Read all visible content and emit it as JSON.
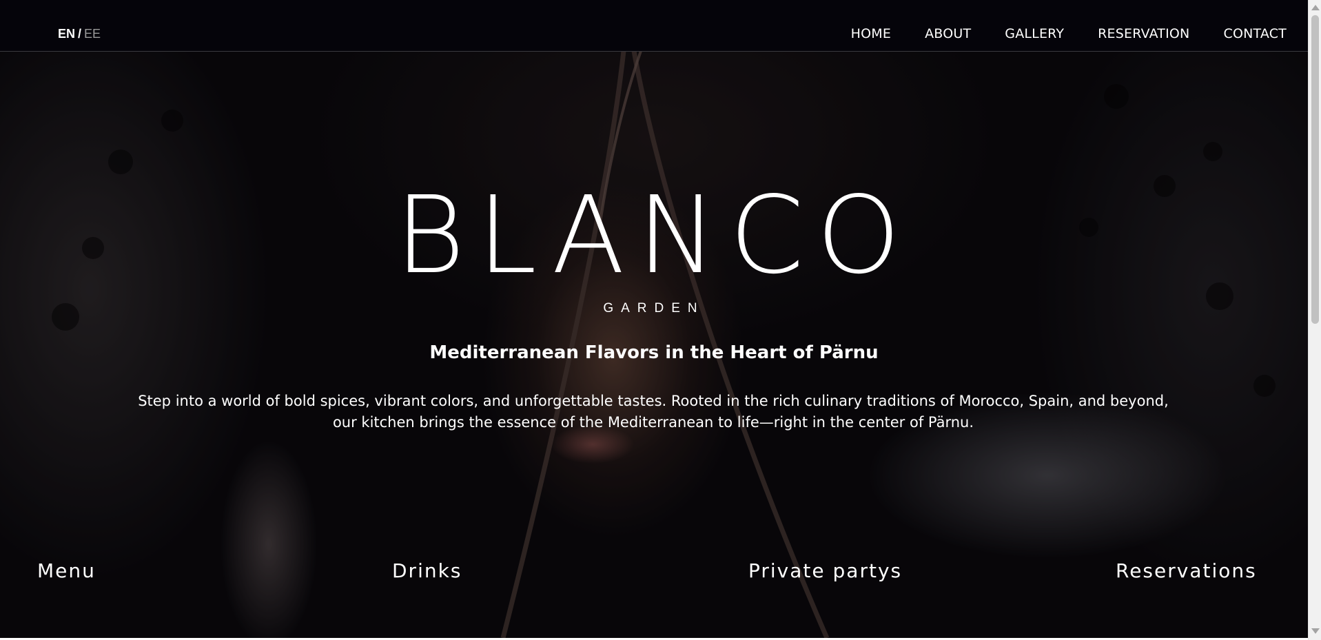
{
  "language": {
    "active": "EN",
    "separator": "/",
    "inactive": "EE"
  },
  "nav": {
    "items": [
      {
        "label": "HOME"
      },
      {
        "label": "ABOUT"
      },
      {
        "label": "GALLERY"
      },
      {
        "label": "RESERVATION"
      },
      {
        "label": "CONTACT"
      }
    ]
  },
  "hero": {
    "logo": "BLANCO",
    "logo_sub": "GARDEN",
    "tagline": "Mediterranean Flavors in the Heart of Pärnu",
    "intro": "Step into a world of bold spices, vibrant colors, and unforgettable tastes. Rooted in the rich culinary traditions of Morocco, Spain, and beyond, our kitchen brings the essence of the Mediterranean to life—right in the center of Pärnu."
  },
  "quick_links": [
    {
      "label": "Menu"
    },
    {
      "label": "Drinks"
    },
    {
      "label": "Private partys"
    },
    {
      "label": "Reservations"
    }
  ],
  "colors": {
    "background": "#06050a",
    "text": "#ffffff",
    "inactive_language": "#9a9a9a"
  }
}
